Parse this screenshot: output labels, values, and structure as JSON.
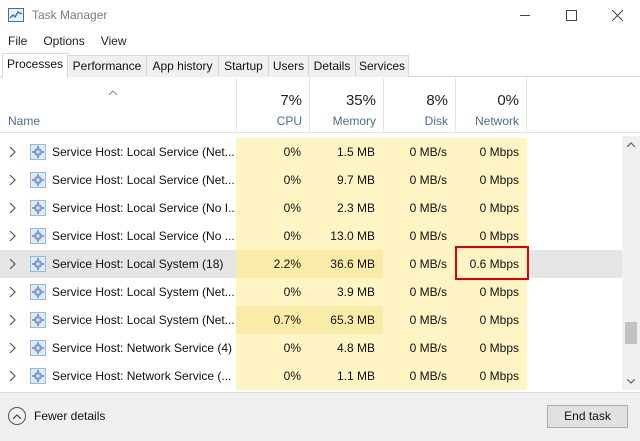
{
  "window": {
    "title": "Task Manager"
  },
  "menu": [
    "File",
    "Options",
    "View"
  ],
  "tabs": [
    "Processes",
    "Performance",
    "App history",
    "Startup",
    "Users",
    "Details",
    "Services"
  ],
  "active_tab": "Processes",
  "header": {
    "name_label": "Name",
    "sort_indicator": "^",
    "columns": [
      {
        "pct": "7%",
        "label": "CPU"
      },
      {
        "pct": "35%",
        "label": "Memory"
      },
      {
        "pct": "8%",
        "label": "Disk"
      },
      {
        "pct": "0%",
        "label": "Network"
      }
    ]
  },
  "processes": [
    {
      "name": "Service Host: Local Service (Net...",
      "cpu": "0%",
      "memory": "1.5 MB",
      "disk": "0 MB/s",
      "network": "0 Mbps"
    },
    {
      "name": "Service Host: Local Service (Net...",
      "cpu": "0%",
      "memory": "9.7 MB",
      "disk": "0 MB/s",
      "network": "0 Mbps"
    },
    {
      "name": "Service Host: Local Service (No I...",
      "cpu": "0%",
      "memory": "2.3 MB",
      "disk": "0 MB/s",
      "network": "0 Mbps"
    },
    {
      "name": "Service Host: Local Service (No ...",
      "cpu": "0%",
      "memory": "13.0 MB",
      "disk": "0 MB/s",
      "network": "0 Mbps"
    },
    {
      "name": "Service Host: Local System (18)",
      "cpu": "2.2%",
      "memory": "36.6 MB",
      "disk": "0 MB/s",
      "network": "0.6 Mbps",
      "selected": true
    },
    {
      "name": "Service Host: Local System (Net...",
      "cpu": "0%",
      "memory": "3.9 MB",
      "disk": "0 MB/s",
      "network": "0 Mbps"
    },
    {
      "name": "Service Host: Local System (Net...",
      "cpu": "0.7%",
      "memory": "65.3 MB",
      "disk": "0 MB/s",
      "network": "0 Mbps"
    },
    {
      "name": "Service Host: Network Service (4)",
      "cpu": "0%",
      "memory": "4.8 MB",
      "disk": "0 MB/s",
      "network": "0 Mbps"
    },
    {
      "name": "Service Host: Network Service (...",
      "cpu": "0%",
      "memory": "1.1 MB",
      "disk": "0 MB/s",
      "network": "0 Mbps"
    }
  ],
  "footer": {
    "fewer_details": "Fewer details",
    "end_task": "End task"
  },
  "colors": {
    "heat_light": "#fff4c4",
    "heat_medium": "#f9eca8",
    "highlight": "#e00000",
    "header_label": "#4b6d95"
  },
  "icons": [
    "task-manager-icon",
    "minimize-icon",
    "maximize-icon",
    "close-icon",
    "chevron-right-icon",
    "service-gear-icon",
    "chevron-up-circle-icon"
  ]
}
